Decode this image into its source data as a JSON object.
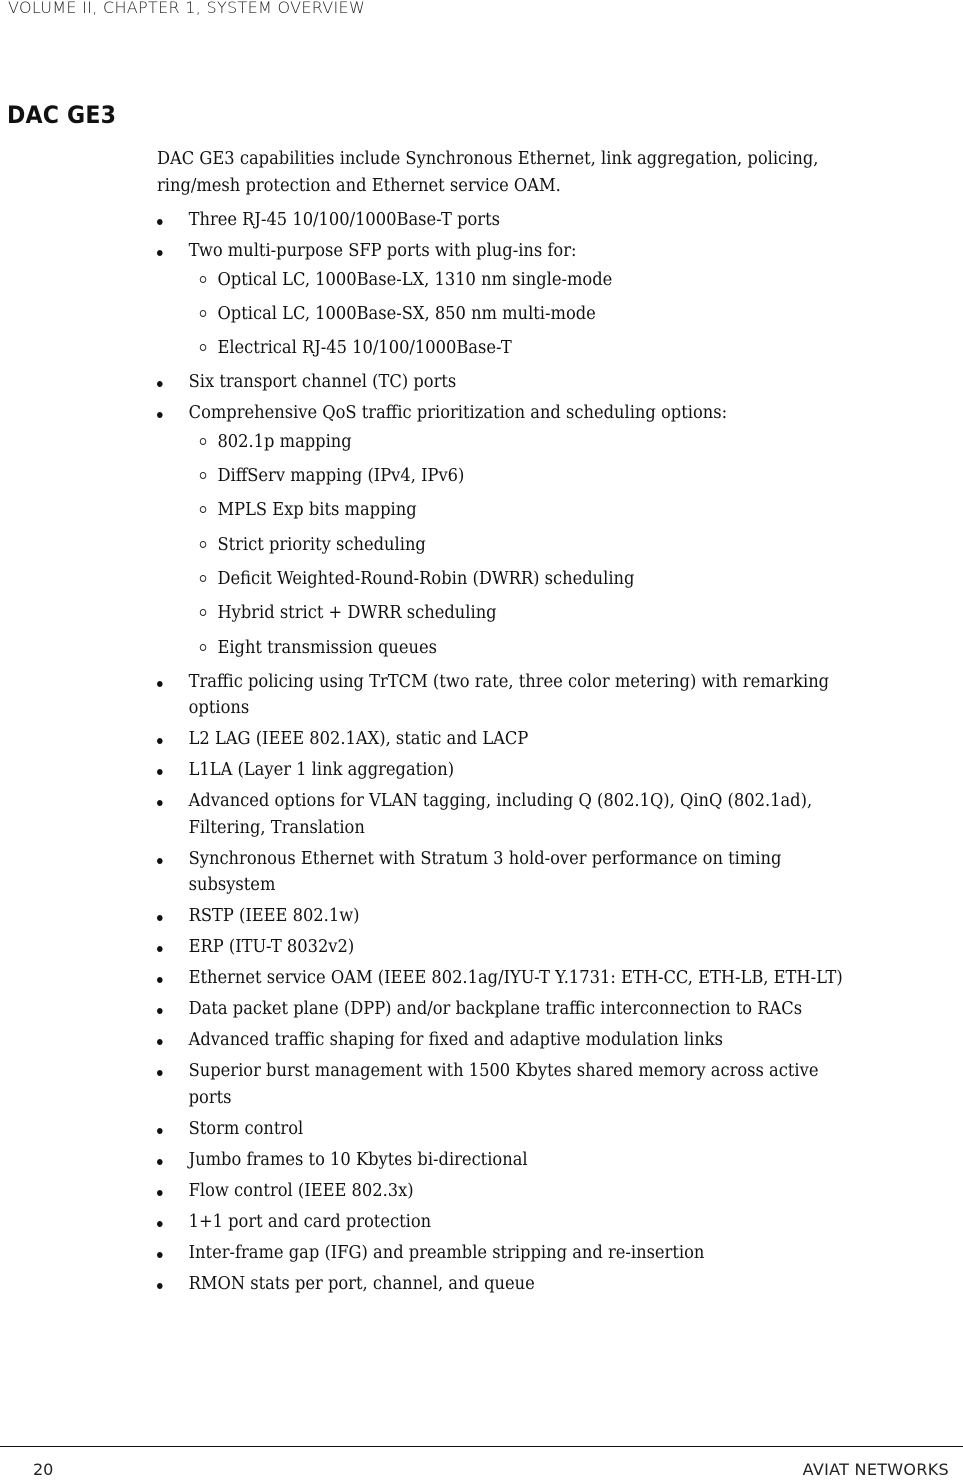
{
  "header": {
    "running_title": "VOLUME II, CHAPTER 1, SYSTEM OVERVIEW"
  },
  "section": {
    "title": "DAC GE3",
    "intro": "DAC GE3 capabilities include Synchronous Ethernet, link aggregation, policing, ring/mesh protection and Ethernet service OAM.",
    "bullets": [
      {
        "text": "Three RJ-45 10/100/1000Base-T ports",
        "sub": []
      },
      {
        "text": "Two multi-purpose SFP ports with plug-ins for:",
        "sub": [
          "Optical LC, 1000Base-LX, 1310 nm single-mode",
          "Optical LC, 1000Base-SX, 850 nm multi-mode",
          "Electrical RJ-45 10/100/1000Base-T"
        ]
      },
      {
        "text": "Six transport channel (TC) ports",
        "sub": []
      },
      {
        "text": "Comprehensive QoS traffic prioritization and scheduling options:",
        "sub": [
          "802.1p mapping",
          "DiffServ mapping (IPv4, IPv6)",
          "MPLS Exp bits mapping",
          "Strict priority scheduling",
          "Deficit Weighted-Round-Robin (DWRR) scheduling",
          "Hybrid strict + DWRR scheduling",
          "Eight transmission queues"
        ]
      },
      {
        "text": "Traffic policing using TrTCM (two rate, three color metering) with remarking options",
        "sub": []
      },
      {
        "text": "L2 LAG (IEEE 802.1AX), static and LACP",
        "sub": []
      },
      {
        "text": "L1LA (Layer 1 link aggregation)",
        "sub": []
      },
      {
        "text": "Advanced options for VLAN tagging, including Q (802.1Q), QinQ (802.1ad), Filtering, Translation",
        "sub": []
      },
      {
        "text": "Synchronous Ethernet with Stratum 3 hold-over performance on timing subsystem",
        "sub": []
      },
      {
        "text": "RSTP (IEEE 802.1w)",
        "sub": []
      },
      {
        "text": "ERP (ITU-T 8032v2)",
        "sub": []
      },
      {
        "text": "Ethernet service OAM (IEEE 802.1ag/IYU-T Y.1731: ETH-CC, ETH-LB, ETH-LT)",
        "sub": []
      },
      {
        "text": "Data packet plane (DPP) and/or backplane traffic interconnection to RACs",
        "sub": []
      },
      {
        "text": "Advanced traffic shaping for fixed and adaptive modulation links",
        "sub": []
      },
      {
        "text": "Superior burst management with 1500 Kbytes shared memory across active ports",
        "sub": []
      },
      {
        "text": "Storm control",
        "sub": []
      },
      {
        "text": "Jumbo frames to 10 Kbytes bi-directional",
        "sub": []
      },
      {
        "text": "Flow control (IEEE 802.3x)",
        "sub": []
      },
      {
        "text": "1+1 port and card protection",
        "sub": []
      },
      {
        "text": "Inter-frame gap (IFG) and preamble stripping and re-insertion",
        "sub": []
      },
      {
        "text": "RMON stats per port, channel, and queue",
        "sub": []
      }
    ]
  },
  "footer": {
    "page_number": "20",
    "brand": "AVIAT NETWORKS"
  }
}
